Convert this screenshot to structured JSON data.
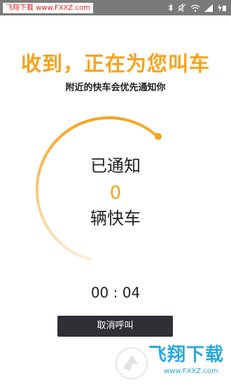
{
  "status_bar": {
    "watermark_text": "飞翔下载 www.FXXZ.com",
    "icons": [
      "bluetooth-icon",
      "mute-icon",
      "wifi-icon",
      "signal-icon",
      "battery-charging-icon"
    ]
  },
  "header": {
    "headline": "收到，正在为您叫车",
    "subtitle": "附近的快车会优先通知你"
  },
  "progress_ring": {
    "notified_label": "已通知",
    "count": "0",
    "car_label": "辆快车"
  },
  "timer": {
    "text": "00 : 04"
  },
  "actions": {
    "cancel_label": "取消呼叫"
  },
  "watermark": {
    "brand_text": "飞翔下载",
    "url_text": "www.FXXZ.com"
  },
  "colors": {
    "accent": "#f7a21b",
    "status_bar": "#7a7a7a",
    "button_bg": "#2e3036",
    "watermark_blue": "#28a8dc"
  }
}
